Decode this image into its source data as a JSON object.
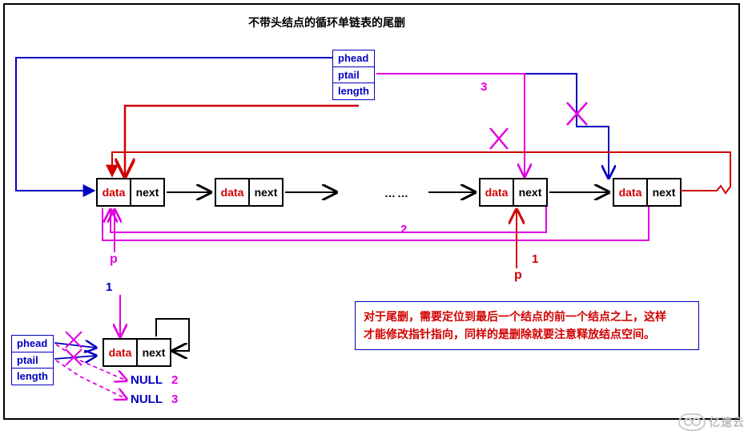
{
  "title": "不带头结点的循环单链表的尾删",
  "struct_main": {
    "phead": "phead",
    "ptail": "ptail",
    "length": "length"
  },
  "struct_small": {
    "phead": "phead",
    "ptail": "ptail",
    "length": "length"
  },
  "node": {
    "data": "data",
    "next": "next"
  },
  "ellipsis": "……",
  "labels": {
    "p_left": "p",
    "p_right": "p",
    "one_left": "1",
    "one_right_red": "1",
    "two_magenta": "2",
    "three_magenta": "3",
    "null2": "NULL",
    "null2_num": "2",
    "null3": "NULL",
    "null3_num": "3"
  },
  "note": {
    "line1": "对于尾删，需要定位到最后一个结点的前一个结点之上，这样",
    "line2": "才能修改指针指向，同样的是删除就要注意释放结点空间。"
  },
  "watermark": "亿速云"
}
